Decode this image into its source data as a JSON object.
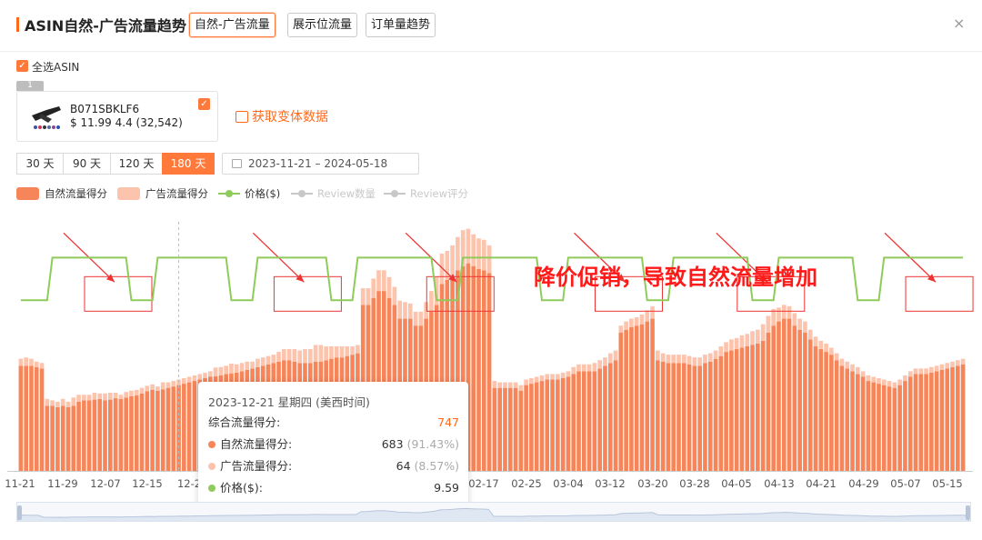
{
  "header": {
    "title": "ASIN自然-广告流量趋势",
    "tabs": [
      {
        "label": "自然-广告流量",
        "active": true
      },
      {
        "label": "展示位流量",
        "active": false
      },
      {
        "label": "订单量趋势",
        "active": false
      }
    ],
    "close_icon": "×"
  },
  "select_all": {
    "label": "全选ASIN",
    "checked": true
  },
  "product": {
    "index": "1",
    "asin": "B071SBKLF6",
    "meta": "$ 11.99 4.4 (32,542)",
    "checked": true
  },
  "fetch_variants": "获取变体数据",
  "ranges": [
    {
      "label": "30 天",
      "active": false
    },
    {
      "label": "90 天",
      "active": false
    },
    {
      "label": "120 天",
      "active": false
    },
    {
      "label": "180 天",
      "active": true
    }
  ],
  "date_range": "2023-11-21   –   2024-05-18",
  "legend": [
    {
      "label": "自然流量得分",
      "color": "#f7855a",
      "kind": "bar",
      "enabled": true
    },
    {
      "label": "广告流量得分",
      "color": "#fcc3ad",
      "kind": "bar",
      "enabled": true
    },
    {
      "label": "价格($)",
      "color": "#8fcb5a",
      "kind": "line",
      "enabled": true
    },
    {
      "label": "Review数量",
      "color": "#c8c8c8",
      "kind": "line",
      "enabled": false
    },
    {
      "label": "Review评分",
      "color": "#c8c8c8",
      "kind": "line",
      "enabled": false
    }
  ],
  "annotation": "降价促销，导致自然流量增加",
  "tooltip": {
    "date": "2023-12-21 星期四 (美西时间)",
    "total_label": "综合流量得分:",
    "total_value": "747",
    "rows": [
      {
        "label": "自然流量得分:",
        "value": "683",
        "pct": "(91.43%)",
        "color": "#f7855a"
      },
      {
        "label": "广告流量得分:",
        "value": "64",
        "pct": "(8.57%)",
        "color": "#fcc3ad"
      },
      {
        "label": "价格($):",
        "value": "9.59",
        "pct": "",
        "color": "#8fcb5a"
      }
    ]
  },
  "chart_data": {
    "type": "bar",
    "x_tick_labels": [
      "11-21",
      "11-29",
      "12-07",
      "12-15",
      "12-2",
      "02-17",
      "02-25",
      "03-04",
      "03-12",
      "03-20",
      "03-28",
      "04-05",
      "04-13",
      "04-21",
      "04-29",
      "05-07",
      "05-15"
    ],
    "series": [
      {
        "name": "自然流量得分",
        "color": "#f7855a",
        "values": [
          760,
          760,
          760,
          750,
          740,
          470,
          470,
          460,
          470,
          460,
          470,
          500,
          510,
          510,
          515,
          520,
          510,
          515,
          525,
          520,
          530,
          540,
          545,
          560,
          575,
          585,
          580,
          590,
          600,
          610,
          620,
          630,
          640,
          650,
          660,
          670,
          680,
          683,
          690,
          700,
          705,
          710,
          720,
          730,
          740,
          750,
          760,
          770,
          780,
          790,
          800,
          800,
          790,
          780,
          780,
          780,
          790,
          790,
          800,
          810,
          820,
          820,
          830,
          840,
          850,
          1200,
          1200,
          1250,
          1300,
          1300,
          1250,
          1200,
          1100,
          1100,
          1100,
          1050,
          1050,
          1100,
          1150,
          1200,
          1350,
          1380,
          1400,
          1450,
          1480,
          1500,
          1480,
          1460,
          1450,
          1430,
          600,
          600,
          600,
          600,
          600,
          580,
          620,
          630,
          640,
          650,
          660,
          660,
          660,
          670,
          680,
          700,
          720,
          720,
          720,
          720,
          740,
          760,
          780,
          800,
          1000,
          1020,
          1040,
          1050,
          1060,
          1080,
          1100,
          800,
          790,
          780,
          780,
          780,
          780,
          770,
          760,
          760,
          780,
          790,
          810,
          830,
          860,
          870,
          880,
          890,
          900,
          910,
          920,
          940,
          1000,
          1050,
          1080,
          1100,
          1100,
          1050,
          1020,
          1000,
          950,
          900,
          880,
          860,
          840,
          800,
          760,
          740,
          720,
          700,
          680,
          650,
          640,
          630,
          620,
          610,
          600,
          620,
          650,
          680,
          700,
          700,
          700,
          710,
          720,
          730,
          740,
          750,
          760,
          770
        ]
      },
      {
        "name": "广告流量得分",
        "color": "#fcc3ad",
        "values": [
          50,
          60,
          50,
          40,
          40,
          50,
          40,
          40,
          50,
          40,
          60,
          50,
          40,
          40,
          50,
          40,
          50,
          50,
          40,
          30,
          40,
          40,
          40,
          40,
          40,
          40,
          30,
          50,
          40,
          40,
          40,
          40,
          40,
          40,
          40,
          40,
          40,
          64,
          60,
          60,
          70,
          60,
          60,
          60,
          50,
          60,
          60,
          60,
          60,
          70,
          80,
          80,
          90,
          90,
          100,
          100,
          120,
          120,
          100,
          90,
          80,
          80,
          70,
          60,
          60,
          120,
          120,
          140,
          150,
          150,
          150,
          130,
          130,
          120,
          110,
          100,
          100,
          120,
          150,
          200,
          220,
          210,
          230,
          240,
          260,
          250,
          230,
          220,
          220,
          200,
          50,
          40,
          40,
          40,
          40,
          40,
          40,
          40,
          40,
          40,
          40,
          40,
          40,
          40,
          40,
          50,
          50,
          50,
          50,
          60,
          60,
          60,
          70,
          70,
          50,
          60,
          60,
          60,
          70,
          80,
          90,
          70,
          60,
          60,
          60,
          60,
          60,
          60,
          60,
          60,
          60,
          60,
          60,
          70,
          70,
          80,
          80,
          90,
          90,
          100,
          100,
          120,
          120,
          120,
          100,
          100,
          90,
          90,
          80,
          80,
          70,
          70,
          60,
          60,
          50,
          50,
          50,
          50,
          50,
          50,
          40,
          40,
          40,
          40,
          40,
          40,
          40,
          40,
          40,
          40,
          40,
          40,
          40,
          40,
          40,
          40,
          40,
          40,
          40,
          40,
          40,
          40,
          40,
          40,
          40
        ]
      },
      {
        "name": "价格($)",
        "color": "#8fcb5a",
        "values": [
          9.59,
          9.59,
          9.59,
          9.59,
          9.59,
          9.59,
          11.99,
          11.99,
          11.99,
          11.99,
          11.99,
          11.99,
          11.99,
          11.99,
          11.99,
          11.99,
          11.99,
          11.99,
          11.99,
          11.99,
          11.99,
          9.59,
          9.59,
          9.59,
          9.59,
          9.59,
          11.99,
          11.99,
          11.99,
          11.99,
          11.99,
          11.99,
          11.99,
          11.99,
          11.99,
          11.99,
          11.99,
          11.99,
          11.99,
          11.99,
          9.59,
          9.59,
          9.59,
          9.59,
          9.59,
          11.99,
          11.99,
          11.99,
          11.99,
          11.99,
          11.99,
          11.99,
          11.99,
          11.99,
          11.99,
          11.99,
          11.99,
          11.99,
          11.99,
          9.59,
          9.59,
          9.59,
          9.59,
          9.59,
          11.99,
          11.99,
          11.99,
          11.99,
          11.99,
          11.99,
          11.99,
          11.99,
          11.99,
          11.99,
          11.99,
          11.99,
          11.99,
          11.99,
          11.99,
          9.59,
          9.59,
          9.59,
          9.59,
          9.59,
          11.99,
          11.99,
          11.99,
          11.99,
          11.99,
          11.99,
          11.99,
          11.99,
          11.99,
          11.99,
          11.99,
          11.99,
          11.99,
          11.99,
          11.99,
          9.59,
          9.59,
          9.59,
          9.59,
          9.59,
          11.99,
          11.99,
          11.99,
          11.99,
          11.99,
          11.99,
          11.99,
          11.99,
          11.99,
          11.99,
          11.99,
          11.99,
          11.99,
          11.99,
          11.99,
          9.59,
          9.59,
          9.59,
          9.59,
          9.59,
          11.99,
          11.99,
          11.99,
          11.99,
          11.99,
          11.99,
          11.99,
          11.99,
          11.99,
          11.99,
          11.99,
          11.99,
          11.99,
          11.99,
          11.99,
          9.59,
          9.59,
          9.59,
          9.59,
          9.59,
          11.99,
          11.99,
          11.99,
          11.99,
          11.99,
          11.99,
          11.99,
          11.99,
          11.99,
          11.99,
          11.99,
          11.99,
          11.99,
          11.99,
          11.99,
          9.59,
          9.59,
          9.59,
          9.59,
          9.59,
          11.99,
          11.99,
          11.99,
          11.99,
          11.99,
          11.99,
          11.99,
          11.99,
          11.99,
          11.99,
          11.99,
          11.99,
          11.99,
          11.99,
          11.99,
          11.99,
          11.99,
          11.99,
          11.99
        ]
      }
    ],
    "ylim": [
      0,
      1800
    ],
    "price_ylim": [
      0,
      14
    ],
    "highlight_boxes_on_days": [
      19,
      55,
      84,
      116,
      143,
      175
    ],
    "grid": false,
    "legend_position": "top-left"
  }
}
